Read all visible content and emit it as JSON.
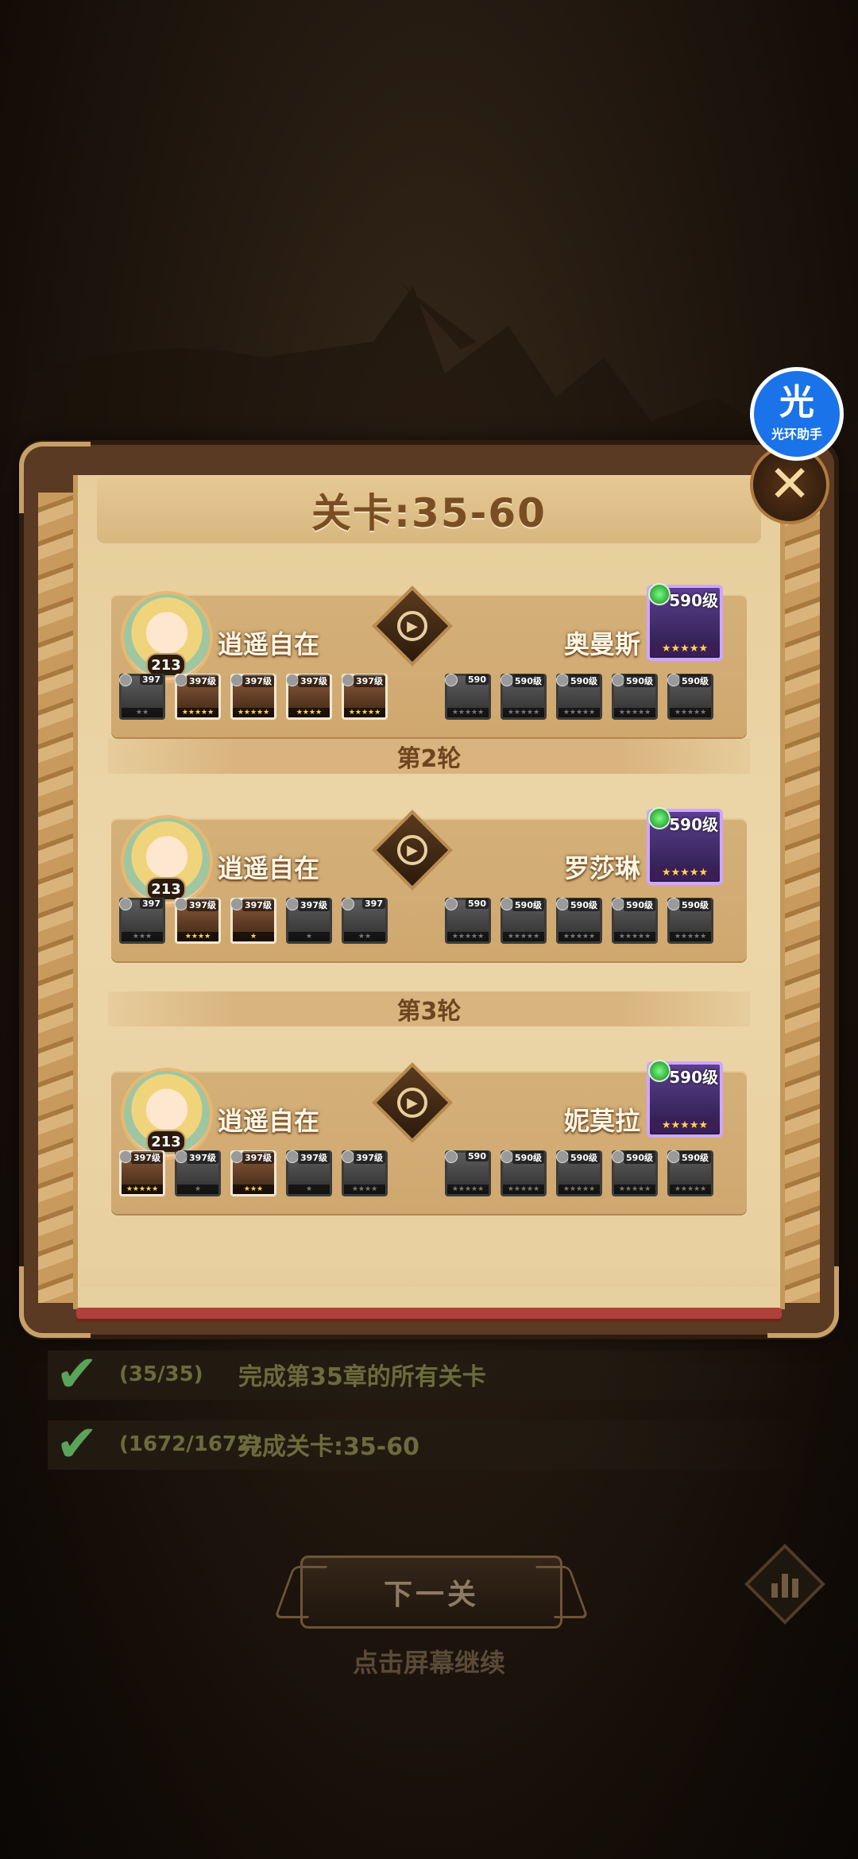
{
  "header": {
    "title": "关卡:35-60"
  },
  "assistant_badge": {
    "icon_text": "光",
    "label": "光环助手"
  },
  "close_icon_text": "✕",
  "rounds": [
    {
      "header": "",
      "player": {
        "name": "逍遥自在",
        "level": "213"
      },
      "enemy": {
        "name": "奥曼斯",
        "level": "590级",
        "stars": "★★★★★"
      },
      "player_heroes": [
        {
          "level": "397",
          "stars": "★★",
          "lit": false
        },
        {
          "level": "397级",
          "stars": "★★★★★",
          "lit": true
        },
        {
          "level": "397级",
          "stars": "★★★★★",
          "lit": true
        },
        {
          "level": "397级",
          "stars": "★★★★",
          "lit": true
        },
        {
          "level": "397级",
          "stars": "★★★★★",
          "lit": true
        }
      ],
      "enemy_heroes": [
        {
          "level": "590",
          "stars": "★★★★★"
        },
        {
          "level": "590级",
          "stars": "★★★★★"
        },
        {
          "level": "590级",
          "stars": "★★★★★"
        },
        {
          "level": "590级",
          "stars": "★★★★★"
        },
        {
          "level": "590级",
          "stars": "★★★★★"
        }
      ]
    },
    {
      "header": "第2轮",
      "player": {
        "name": "逍遥自在",
        "level": "213"
      },
      "enemy": {
        "name": "罗莎琳",
        "level": "590级",
        "stars": "★★★★★"
      },
      "player_heroes": [
        {
          "level": "397",
          "stars": "★★★",
          "lit": false
        },
        {
          "level": "397级",
          "stars": "★★★★",
          "lit": true
        },
        {
          "level": "397级",
          "stars": "★",
          "lit": true
        },
        {
          "level": "397级",
          "stars": "★",
          "lit": false
        },
        {
          "level": "397",
          "stars": "★★",
          "lit": false
        }
      ],
      "enemy_heroes": [
        {
          "level": "590",
          "stars": "★★★★★"
        },
        {
          "level": "590级",
          "stars": "★★★★★"
        },
        {
          "level": "590级",
          "stars": "★★★★★"
        },
        {
          "level": "590级",
          "stars": "★★★★★"
        },
        {
          "level": "590级",
          "stars": "★★★★★"
        }
      ]
    },
    {
      "header": "第3轮",
      "player": {
        "name": "逍遥自在",
        "level": "213"
      },
      "enemy": {
        "name": "妮莫拉",
        "level": "590级",
        "stars": "★★★★★"
      },
      "player_heroes": [
        {
          "level": "397级",
          "stars": "★★★★★",
          "lit": true
        },
        {
          "level": "397级",
          "stars": "★",
          "lit": false
        },
        {
          "level": "397级",
          "stars": "★★★",
          "lit": true
        },
        {
          "level": "397级",
          "stars": "★",
          "lit": false
        },
        {
          "level": "397级",
          "stars": "★★★★",
          "lit": false
        }
      ],
      "enemy_heroes": [
        {
          "level": "590",
          "stars": "★★★★★"
        },
        {
          "level": "590级",
          "stars": "★★★★★"
        },
        {
          "level": "590级",
          "stars": "★★★★★"
        },
        {
          "level": "590级",
          "stars": "★★★★★"
        },
        {
          "level": "590级",
          "stars": "★★★★★"
        }
      ]
    }
  ],
  "tasks": [
    {
      "count": "(35/35)",
      "desc": "完成第35章的所有关卡"
    },
    {
      "count": "(1672/1672)",
      "desc": "完成关卡:35-60"
    }
  ],
  "footer": {
    "next_label": "下一关",
    "continue_hint": "点击屏幕继续"
  },
  "colors": {
    "panel": "#ecd6a8",
    "title": "#7a4e23",
    "check": "#5aa35a",
    "badge": "#1a73e8"
  }
}
